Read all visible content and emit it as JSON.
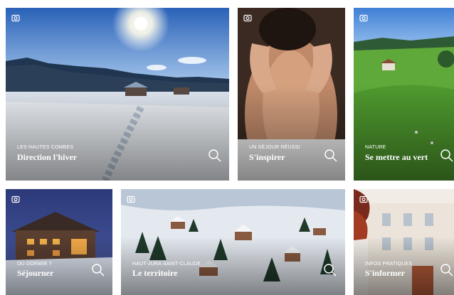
{
  "tiles": [
    {
      "kicker": "LES HAUTES COMBES",
      "title": "Direction l'hiver",
      "camera_icon": "camera-icon",
      "zoom_icon": "search-icon"
    },
    {
      "kicker": "UN SÉJOUR RÉUSSI",
      "title": "S'inspirer",
      "camera_icon": "camera-icon",
      "zoom_icon": "search-icon"
    },
    {
      "kicker": "NATURE",
      "title": "Se mettre au vert",
      "camera_icon": "camera-icon",
      "zoom_icon": "search-icon"
    },
    {
      "kicker": "OÙ DORMIR ?",
      "title": "Séjourner",
      "camera_icon": "camera-icon",
      "zoom_icon": "search-icon"
    },
    {
      "kicker": "HAUT-JURA SAINT-CLAUDE",
      "title": "Le territoire",
      "camera_icon": "camera-icon",
      "zoom_icon": "search-icon"
    },
    {
      "kicker": "INFOS PRATIQUES",
      "title": "S'informer",
      "camera_icon": "camera-icon",
      "zoom_icon": "search-icon"
    }
  ]
}
